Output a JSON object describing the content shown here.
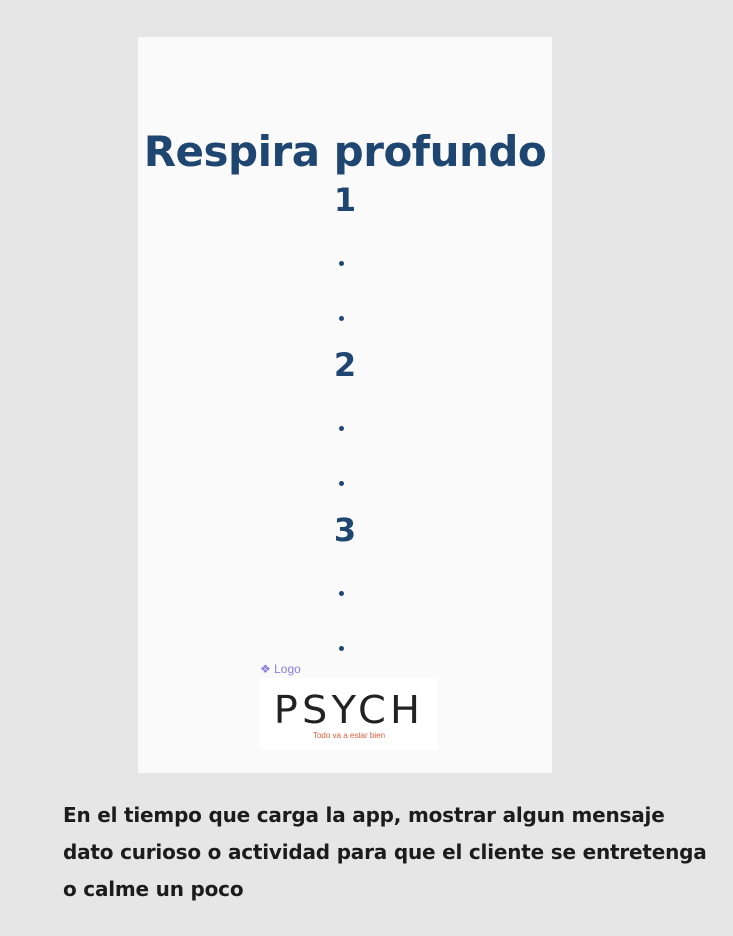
{
  "loading_screen": {
    "title": "Respira profundo",
    "counts": [
      "1",
      "2",
      "3"
    ],
    "logo_label": "❖ Logo",
    "logo": {
      "wordmark": "PSYCH",
      "tagline": "Todo va a estar bien"
    }
  },
  "annotation": {
    "line1": "En el tiempo que carga la app, mostrar algun mensaje",
    "line2": "dato curioso o actividad para que el cliente se entretenga",
    "line3": "o calme un poco"
  },
  "colors": {
    "canvas": "#e6e6e6",
    "frame": "#fafafa",
    "primary_text": "#1f4671",
    "logo_label": "#8a7de0",
    "tagline": "#e0623e"
  }
}
